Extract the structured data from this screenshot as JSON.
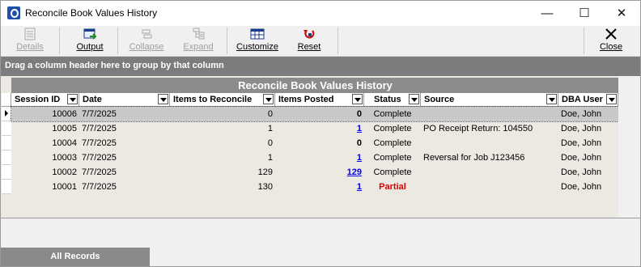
{
  "window": {
    "title": "Reconcile Book Values History",
    "minimize": "—",
    "maximize": "☐",
    "close": "✕"
  },
  "toolbar": {
    "details": "Details",
    "output": "Output",
    "collapse": "Collapse",
    "expand": "Expand",
    "customize": "Customize",
    "reset": "Reset",
    "close": "Close"
  },
  "group_hint": "Drag a column header here to group by that column",
  "grid": {
    "title": "Reconcile Book Values History",
    "columns": [
      "Session ID",
      "Date",
      "Items to Reconcile",
      "Items Posted",
      "Status",
      "Source",
      "DBA User"
    ],
    "rows": [
      {
        "session_id": "10006",
        "date": "7/7/2025",
        "items_to_reconcile": "0",
        "items_posted": "0",
        "status": "Complete",
        "source": "",
        "dba_user": "Doe, John"
      },
      {
        "session_id": "10005",
        "date": "7/7/2025",
        "items_to_reconcile": "1",
        "items_posted": "1",
        "status": "Complete",
        "source": "PO Receipt Return: 104550",
        "dba_user": "Doe, John"
      },
      {
        "session_id": "10004",
        "date": "7/7/2025",
        "items_to_reconcile": "0",
        "items_posted": "0",
        "status": "Complete",
        "source": "",
        "dba_user": "Doe, John"
      },
      {
        "session_id": "10003",
        "date": "7/7/2025",
        "items_to_reconcile": "1",
        "items_posted": "1",
        "status": "Complete",
        "source": "Reversal for Job J123456",
        "dba_user": "Doe, John"
      },
      {
        "session_id": "10002",
        "date": "7/7/2025",
        "items_to_reconcile": "129",
        "items_posted": "129",
        "status": "Complete",
        "source": "",
        "dba_user": "Doe, John"
      },
      {
        "session_id": "10001",
        "date": "7/7/2025",
        "items_to_reconcile": "130",
        "items_posted": "1",
        "status": "Partial",
        "source": "",
        "dba_user": "Doe, John"
      }
    ]
  },
  "tab": {
    "label": "All Records"
  }
}
